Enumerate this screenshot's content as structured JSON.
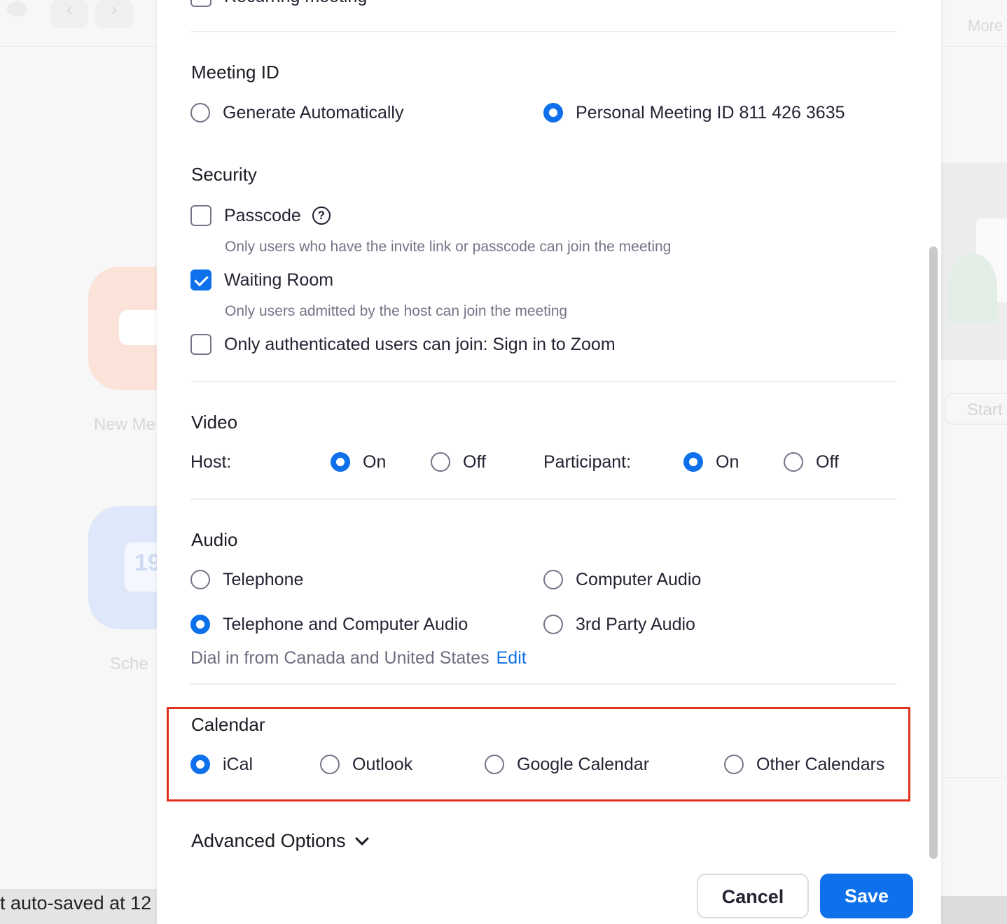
{
  "background": {
    "more_label": "More",
    "new_meeting_label": "New Me",
    "schedule_label": "Sche",
    "calendar_day": "19",
    "start_label": "Start",
    "autosave_text": "t auto-saved at 12"
  },
  "dialog": {
    "recurring_label": "Recurring meeting",
    "meeting_id": {
      "title": "Meeting ID",
      "generate_label": "Generate Automatically",
      "personal_label": "Personal Meeting ID 811 426 3635",
      "selected": "personal"
    },
    "security": {
      "title": "Security",
      "passcode_label": "Passcode",
      "passcode_checked": false,
      "passcode_hint": "Only users who have the invite link or passcode can join the meeting",
      "waiting_room_label": "Waiting Room",
      "waiting_room_checked": true,
      "waiting_room_hint": "Only users admitted by the host can join the meeting",
      "auth_label": "Only authenticated users can join: Sign in to Zoom",
      "auth_checked": false
    },
    "video": {
      "title": "Video",
      "host_label": "Host:",
      "participant_label": "Participant:",
      "on_label": "On",
      "off_label": "Off",
      "host_selected": "On",
      "participant_selected": "On"
    },
    "audio": {
      "title": "Audio",
      "telephone_label": "Telephone",
      "computer_label": "Computer Audio",
      "both_label": "Telephone and Computer Audio",
      "third_party_label": "3rd Party Audio",
      "selected": "both",
      "dial_in_text": "Dial in from Canada and United States",
      "edit_label": "Edit"
    },
    "calendar": {
      "title": "Calendar",
      "ical_label": "iCal",
      "outlook_label": "Outlook",
      "google_label": "Google Calendar",
      "other_label": "Other Calendars",
      "selected": "iCal"
    },
    "advanced_label": "Advanced Options",
    "cancel_label": "Cancel",
    "save_label": "Save"
  },
  "colors": {
    "accent": "#0e71eb",
    "highlight_border": "#e0301e"
  }
}
